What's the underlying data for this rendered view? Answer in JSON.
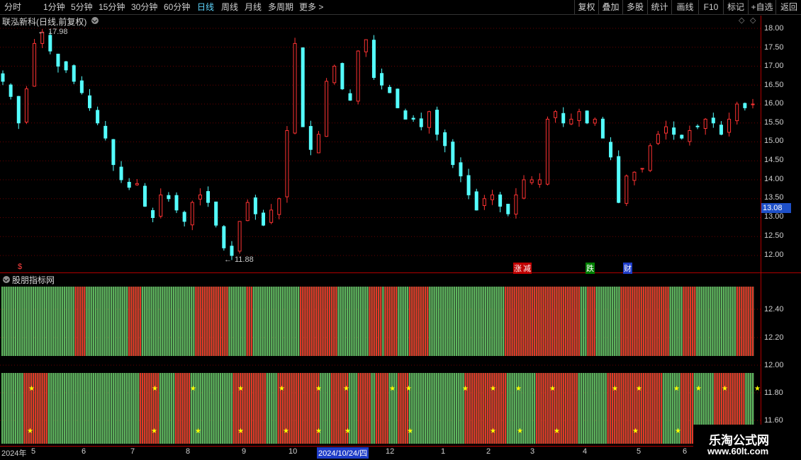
{
  "toolbar": {
    "periods": [
      "分时",
      "1分钟",
      "5分钟",
      "15分钟",
      "30分钟",
      "60分钟",
      "日线",
      "周线",
      "月线",
      "多周期",
      "更多 >"
    ],
    "active_period": "日线",
    "right_buttons": [
      "复权",
      "叠加",
      "多股",
      "统计",
      "画线",
      "F10",
      "标记",
      "+自选",
      "返回"
    ]
  },
  "main_chart": {
    "title": "联泓新科(日线,前复权)",
    "high_label": "17.98",
    "low_label": "11.88",
    "current_price": "13.08",
    "price_ticks": [
      "18.00",
      "17.50",
      "17.00",
      "16.50",
      "16.00",
      "15.50",
      "15.00",
      "14.50",
      "14.00",
      "13.50",
      "13.00",
      "12.50",
      "12.00"
    ],
    "event_markers": [
      "$",
      "涨",
      "减",
      "跌",
      "财"
    ],
    "colors": {
      "up": "#ff3232",
      "down": "#54ffff",
      "current_bg": "#1e50c8"
    }
  },
  "indicator": {
    "title": "股朋指标网",
    "ticks": [
      "12.40",
      "12.20",
      "12.00",
      "11.80",
      "11.60"
    ],
    "star_glyph": "★"
  },
  "x_axis": {
    "labels": [
      "2024年",
      "5",
      "6",
      "7",
      "8",
      "9",
      "10",
      "12",
      "1",
      "2",
      "3",
      "4",
      "5",
      "6"
    ],
    "highlight_date": "2024/10/24/四"
  },
  "watermark": {
    "name": "乐淘公式网",
    "url": "www.60lt.com"
  },
  "chart_data": {
    "type": "candlestick",
    "series": [
      {
        "name": "",
        "approx_closes": [
          16.6,
          16.2,
          15.5,
          16.4,
          17.6,
          17.9,
          17.4,
          17.0,
          16.9,
          16.6,
          16.3,
          15.9,
          15.5,
          15.1,
          14.4,
          14.0,
          13.8,
          13.9,
          13.3,
          13.0,
          13.6,
          13.5,
          13.2,
          12.9,
          13.4,
          13.6,
          13.4,
          12.8,
          12.2,
          12.0,
          12.9,
          13.4,
          13.1,
          12.8,
          13.2,
          13.5,
          15.3,
          17.6,
          15.4,
          14.8,
          15.2,
          16.6,
          17.0,
          16.4,
          16.1,
          17.4,
          17.7,
          16.7,
          16.5,
          16.3,
          15.9,
          15.6,
          15.6,
          15.4,
          15.8,
          15.2,
          14.9,
          14.4,
          14.1,
          13.6,
          13.2,
          13.5,
          13.6,
          13.3,
          13.1,
          13.6,
          14.0,
          14.0,
          14.0,
          15.6,
          15.8,
          15.5,
          15.6,
          15.8,
          15.5,
          15.6,
          15.1,
          14.6,
          13.4,
          14.1,
          14.2,
          14.3,
          14.9,
          15.2,
          15.4,
          15.2,
          15.1,
          15.3,
          15.4,
          15.6,
          15.5,
          15.2,
          15.6,
          16.0,
          15.9,
          16.0
        ]
      }
    ],
    "high": 17.98,
    "low": 11.88,
    "last": 13.08,
    "ylim": [
      11.75,
      18.1
    ]
  }
}
